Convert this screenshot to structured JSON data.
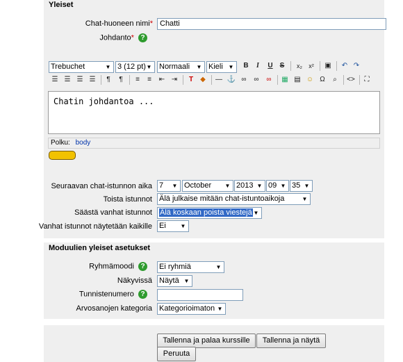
{
  "general": {
    "legend": "Yleiset",
    "name_label": "Chat-huoneen nimi",
    "name_value": "Chatti",
    "intro_label": "Johdanto",
    "editor": {
      "font_family": "Trebuchet",
      "font_size": "3 (12 pt)",
      "style": "Normaali",
      "language": "Kieli",
      "content": "Chatin johdantoa ...",
      "path_label": "Polku:",
      "path_value": "body"
    },
    "next_session_label": "Seuraavan chat-istunnon aika",
    "date": {
      "day": "7",
      "month": "October",
      "year": "2013",
      "hour": "09",
      "minute": "35"
    },
    "repeat_label": "Toista istunnot",
    "repeat_value": "Älä julkaise mitään chat-istuntoaikoja",
    "save_label": "Säästä vanhat istunnot",
    "save_value": "Älä koskaan poista viestejä",
    "show_label": "Vanhat istunnot näytetään kaikille",
    "show_value": "Ei"
  },
  "common": {
    "legend": "Moduulien yleiset asetukset",
    "group_label": "Ryhmämoodi",
    "group_value": "Ei ryhmiä",
    "visible_label": "Näkyvissä",
    "visible_value": "Näytä",
    "idnumber_label": "Tunnistenumero",
    "idnumber_value": "",
    "gradecat_label": "Arvosanojen kategoria",
    "gradecat_value": "Kategorioimaton"
  },
  "buttons": {
    "save_return": "Tallenna ja palaa kurssille",
    "save_display": "Tallenna ja näytä",
    "cancel": "Peruuta"
  },
  "icons": {
    "help": "?",
    "required": "*",
    "dropdown": "▼"
  }
}
